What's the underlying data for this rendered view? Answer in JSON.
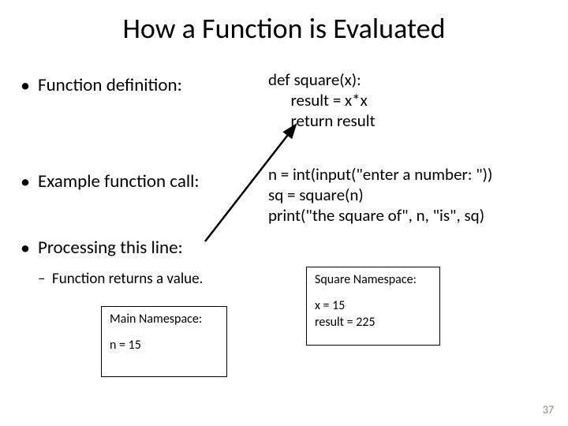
{
  "title": "How a Function is Evaluated",
  "bullets": {
    "b1": "Function definition:",
    "b2": "Example function call:",
    "b3": "Processing this line:",
    "sub1": "Function returns a value."
  },
  "code": {
    "def_l1": "def square(x):",
    "def_l2": "      result = x*x",
    "def_l3": "      return result",
    "call_l1": "n = int(input(\"enter a number: \"))",
    "call_l2": "sq = square(n)",
    "call_l3": "print(\"the square of\", n, \"is\", sq)"
  },
  "boxes": {
    "main_title": "Main Namespace:",
    "main_l1": "n = 15",
    "sq_title": "Square Namespace:",
    "sq_l1": "x = 15",
    "sq_l2": "result = 225"
  },
  "slide_number": "37"
}
